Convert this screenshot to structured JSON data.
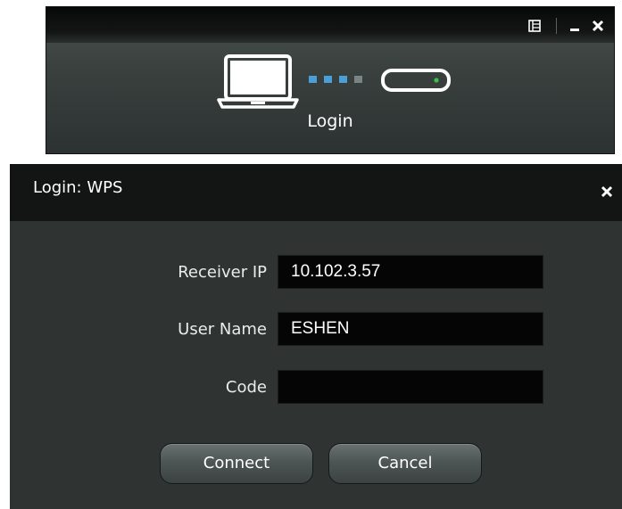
{
  "top_window": {
    "controls": {
      "menu_icon": "menu-icon",
      "minimize_glyph": "_",
      "close_glyph": "✕"
    },
    "status_text": "Login",
    "connection": {
      "laptop_icon": "laptop-icon",
      "device_icon": "receiver-device-icon",
      "active_dots": 3,
      "total_dots": 4,
      "active_color": "#4a9fd8",
      "device_led_color": "#3cc24a"
    }
  },
  "dialog": {
    "title": "Login: WPS",
    "close_glyph": "✕",
    "fields": {
      "receiver_ip": {
        "label": "Receiver IP",
        "value": "10.102.3.57"
      },
      "user_name": {
        "label": "User Name",
        "value": "ESHEN"
      },
      "code": {
        "label": "Code",
        "value": ""
      }
    },
    "buttons": {
      "connect": "Connect",
      "cancel": "Cancel"
    }
  }
}
